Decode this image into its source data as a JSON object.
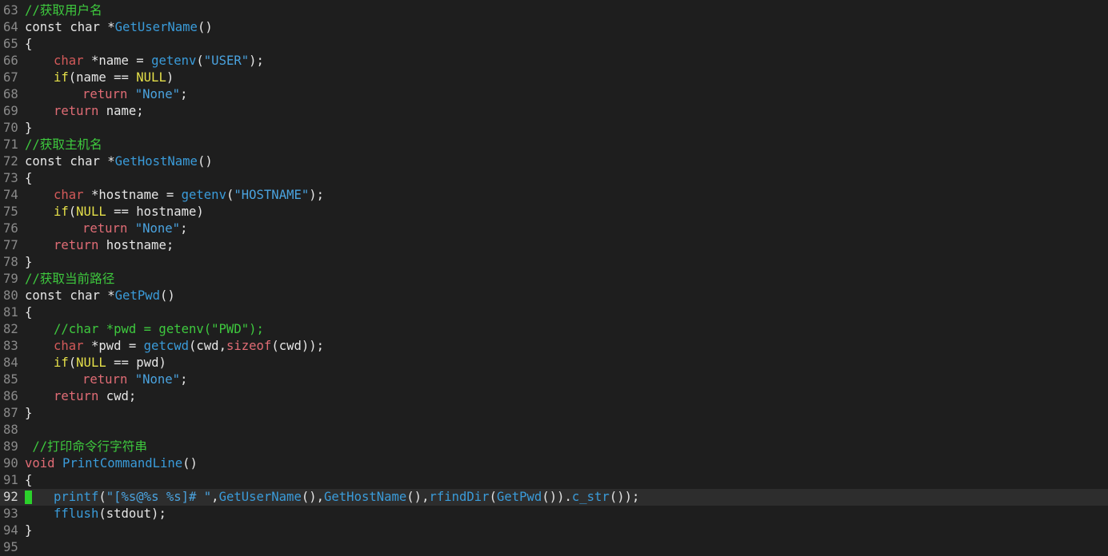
{
  "colors": {
    "background": "#1e1e1e",
    "current_line": "#2d2d2d",
    "line_number": "#8a8a8a",
    "text": "#e6e6e6",
    "comment": "#3ec93e",
    "keyword": "#e06c75",
    "type": "#d35a5a",
    "function": "#3a9bd9",
    "string": "#4aa3df",
    "constant": "#e5e04a",
    "control": "#e5e04a",
    "cursor": "#2bd12b"
  },
  "lines": [
    {
      "num": "63",
      "indent": 0,
      "tokens": [
        {
          "t": "//获取用户名",
          "c": "comment"
        }
      ]
    },
    {
      "num": "64",
      "indent": 0,
      "tokens": [
        {
          "t": "const char ",
          "c": "text"
        },
        {
          "t": "*",
          "c": "text"
        },
        {
          "t": "GetUserName",
          "c": "function"
        },
        {
          "t": "()",
          "c": "text"
        }
      ]
    },
    {
      "num": "65",
      "indent": 0,
      "tokens": [
        {
          "t": "{",
          "c": "text"
        }
      ]
    },
    {
      "num": "66",
      "indent": 1,
      "tokens": [
        {
          "t": "char",
          "c": "type"
        },
        {
          "t": " *name = ",
          "c": "text"
        },
        {
          "t": "getenv",
          "c": "function"
        },
        {
          "t": "(",
          "c": "text"
        },
        {
          "t": "\"USER\"",
          "c": "string"
        },
        {
          "t": ");",
          "c": "text"
        }
      ]
    },
    {
      "num": "67",
      "indent": 1,
      "tokens": [
        {
          "t": "if",
          "c": "control"
        },
        {
          "t": "(name == ",
          "c": "text"
        },
        {
          "t": "NULL",
          "c": "constant"
        },
        {
          "t": ")",
          "c": "text"
        }
      ]
    },
    {
      "num": "68",
      "indent": 2,
      "tokens": [
        {
          "t": "return",
          "c": "keyword"
        },
        {
          "t": " ",
          "c": "text"
        },
        {
          "t": "\"None\"",
          "c": "string"
        },
        {
          "t": ";",
          "c": "text"
        }
      ]
    },
    {
      "num": "69",
      "indent": 1,
      "tokens": [
        {
          "t": "return",
          "c": "keyword"
        },
        {
          "t": " name;",
          "c": "text"
        }
      ]
    },
    {
      "num": "70",
      "indent": 0,
      "tokens": [
        {
          "t": "}",
          "c": "text"
        }
      ]
    },
    {
      "num": "71",
      "indent": 0,
      "tokens": [
        {
          "t": "//获取主机名",
          "c": "comment"
        }
      ]
    },
    {
      "num": "72",
      "indent": 0,
      "tokens": [
        {
          "t": "const char ",
          "c": "text"
        },
        {
          "t": "*",
          "c": "text"
        },
        {
          "t": "GetHostName",
          "c": "function"
        },
        {
          "t": "()",
          "c": "text"
        }
      ]
    },
    {
      "num": "73",
      "indent": 0,
      "tokens": [
        {
          "t": "{",
          "c": "text"
        }
      ]
    },
    {
      "num": "74",
      "indent": 1,
      "tokens": [
        {
          "t": "char",
          "c": "type"
        },
        {
          "t": " *hostname = ",
          "c": "text"
        },
        {
          "t": "getenv",
          "c": "function"
        },
        {
          "t": "(",
          "c": "text"
        },
        {
          "t": "\"HOSTNAME\"",
          "c": "string"
        },
        {
          "t": ");",
          "c": "text"
        }
      ]
    },
    {
      "num": "75",
      "indent": 1,
      "tokens": [
        {
          "t": "if",
          "c": "control"
        },
        {
          "t": "(",
          "c": "text"
        },
        {
          "t": "NULL",
          "c": "constant"
        },
        {
          "t": " == hostname)",
          "c": "text"
        }
      ]
    },
    {
      "num": "76",
      "indent": 2,
      "tokens": [
        {
          "t": "return",
          "c": "keyword"
        },
        {
          "t": " ",
          "c": "text"
        },
        {
          "t": "\"None\"",
          "c": "string"
        },
        {
          "t": ";",
          "c": "text"
        }
      ]
    },
    {
      "num": "77",
      "indent": 1,
      "tokens": [
        {
          "t": "return",
          "c": "keyword"
        },
        {
          "t": " hostname;",
          "c": "text"
        }
      ]
    },
    {
      "num": "78",
      "indent": 0,
      "tokens": [
        {
          "t": "}",
          "c": "text"
        }
      ]
    },
    {
      "num": "79",
      "indent": 0,
      "tokens": [
        {
          "t": "//获取当前路径",
          "c": "comment"
        }
      ]
    },
    {
      "num": "80",
      "indent": 0,
      "tokens": [
        {
          "t": "const char ",
          "c": "text"
        },
        {
          "t": "*",
          "c": "text"
        },
        {
          "t": "GetPwd",
          "c": "function"
        },
        {
          "t": "()",
          "c": "text"
        }
      ]
    },
    {
      "num": "81",
      "indent": 0,
      "tokens": [
        {
          "t": "{",
          "c": "text"
        }
      ]
    },
    {
      "num": "82",
      "indent": 1,
      "tokens": [
        {
          "t": "//char *pwd = getenv(\"PWD\");",
          "c": "comment"
        }
      ]
    },
    {
      "num": "83",
      "indent": 1,
      "tokens": [
        {
          "t": "char",
          "c": "type"
        },
        {
          "t": " *pwd = ",
          "c": "text"
        },
        {
          "t": "getcwd",
          "c": "function"
        },
        {
          "t": "(cwd,",
          "c": "text"
        },
        {
          "t": "sizeof",
          "c": "keyword"
        },
        {
          "t": "(cwd));",
          "c": "text"
        }
      ]
    },
    {
      "num": "84",
      "indent": 1,
      "tokens": [
        {
          "t": "if",
          "c": "control"
        },
        {
          "t": "(",
          "c": "text"
        },
        {
          "t": "NULL",
          "c": "constant"
        },
        {
          "t": " == pwd)",
          "c": "text"
        }
      ]
    },
    {
      "num": "85",
      "indent": 2,
      "tokens": [
        {
          "t": "return",
          "c": "keyword"
        },
        {
          "t": " ",
          "c": "text"
        },
        {
          "t": "\"None\"",
          "c": "string"
        },
        {
          "t": ";",
          "c": "text"
        }
      ]
    },
    {
      "num": "86",
      "indent": 1,
      "tokens": [
        {
          "t": "return",
          "c": "keyword"
        },
        {
          "t": " cwd;",
          "c": "text"
        }
      ]
    },
    {
      "num": "87",
      "indent": 0,
      "tokens": [
        {
          "t": "}",
          "c": "text"
        }
      ]
    },
    {
      "num": "88",
      "indent": 0,
      "tokens": []
    },
    {
      "num": "89",
      "indent": 0,
      "tokens": [
        {
          "t": " //打印命令行字符串",
          "c": "comment"
        }
      ]
    },
    {
      "num": "90",
      "indent": 0,
      "tokens": [
        {
          "t": "void",
          "c": "keyword"
        },
        {
          "t": " ",
          "c": "text"
        },
        {
          "t": "PrintCommandLine",
          "c": "function"
        },
        {
          "t": "()",
          "c": "text"
        }
      ]
    },
    {
      "num": "91",
      "indent": 0,
      "tokens": [
        {
          "t": "{",
          "c": "text"
        }
      ]
    },
    {
      "num": "92",
      "indent": 1,
      "current": true,
      "tokens": [
        {
          "t": "printf",
          "c": "function"
        },
        {
          "t": "(",
          "c": "text"
        },
        {
          "t": "\"[%s@%s %s]# \"",
          "c": "string"
        },
        {
          "t": ",",
          "c": "text"
        },
        {
          "t": "GetUserName",
          "c": "function"
        },
        {
          "t": "(),",
          "c": "text"
        },
        {
          "t": "GetHostName",
          "c": "function"
        },
        {
          "t": "(),",
          "c": "text"
        },
        {
          "t": "rfindDir",
          "c": "function"
        },
        {
          "t": "(",
          "c": "text"
        },
        {
          "t": "GetPwd",
          "c": "function"
        },
        {
          "t": "()).",
          "c": "text"
        },
        {
          "t": "c_str",
          "c": "function"
        },
        {
          "t": "());",
          "c": "text"
        }
      ]
    },
    {
      "num": "93",
      "indent": 1,
      "tokens": [
        {
          "t": "fflush",
          "c": "function"
        },
        {
          "t": "(stdout);",
          "c": "text"
        }
      ]
    },
    {
      "num": "94",
      "indent": 0,
      "tokens": [
        {
          "t": "}",
          "c": "text"
        }
      ]
    },
    {
      "num": "95",
      "indent": 0,
      "tokens": []
    }
  ]
}
